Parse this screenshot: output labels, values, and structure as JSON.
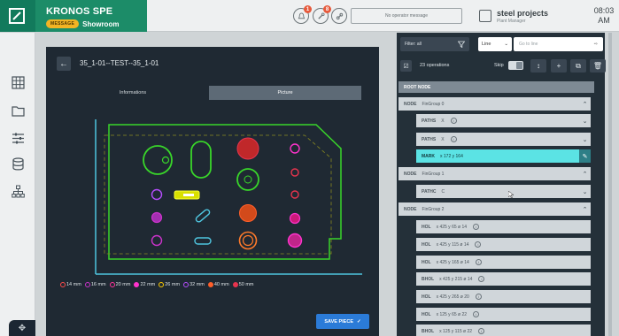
{
  "app": {
    "title": "KRONOS SPE",
    "badge": "MESSAGE",
    "mode": "Showroom",
    "notifications": [
      {
        "icon": "alert-bell-icon",
        "count": "1"
      },
      {
        "icon": "tool-icon",
        "count": "8"
      },
      {
        "icon": "link-icon",
        "count": ""
      }
    ],
    "operator_message": "No operator message",
    "plant": {
      "name": "steel projects",
      "role": "Plant Manager"
    },
    "clock": {
      "time": "08:03",
      "period": "AM"
    }
  },
  "nav": {
    "items": [
      "grid-icon",
      "folder-icon",
      "sliders-icon",
      "database-icon",
      "hierarchy-icon"
    ],
    "bottom_icon": "move-icon"
  },
  "main": {
    "part_title": "35_1-01--TEST--35_1-01",
    "tabs": [
      "Informations",
      "Picture"
    ],
    "active_tab": "Picture",
    "legend": [
      {
        "label": "14 mm",
        "color": "#ff4a4a"
      },
      {
        "label": "16 mm",
        "color": "#cc33cc"
      },
      {
        "label": "20 mm",
        "color": "#ff3399"
      },
      {
        "label": "22 mm",
        "color": "#ff33cc"
      },
      {
        "label": "26 mm",
        "color": "#ffcc00"
      },
      {
        "label": "32 mm",
        "color": "#b64dff"
      },
      {
        "label": "40 mm",
        "color": "#ff5f2a"
      },
      {
        "label": "50 mm",
        "color": "#e8344e"
      }
    ],
    "save_label": "SAVE PIECE"
  },
  "right": {
    "filter": "Filter: all",
    "line_select": "Line",
    "line_placeholder": "Go to line",
    "operations": "23 operations",
    "skip_label": "Skip",
    "tree_header": "ROOT NODE",
    "rows": [
      {
        "kind": "node",
        "kw": "NODE",
        "text": "FinGroup 0",
        "expanded": true
      },
      {
        "kind": "sub",
        "kw": "PATHS",
        "text": "X",
        "info": true
      },
      {
        "kind": "sub",
        "kw": "PATHS",
        "text": "X",
        "info": true
      },
      {
        "kind": "mark",
        "kw": "MARK",
        "text": "x 172 y 164"
      },
      {
        "kind": "node",
        "kw": "NODE",
        "text": "FinGroup 1",
        "expanded": true
      },
      {
        "kind": "sub",
        "kw": "PATHC",
        "text": "C"
      },
      {
        "kind": "node",
        "kw": "NODE",
        "text": "FinGroup 2",
        "expanded": true
      },
      {
        "kind": "op",
        "kw": "HOL",
        "text": "x 425 y 65 ø 14",
        "info": true
      },
      {
        "kind": "op",
        "kw": "HOL",
        "text": "x 425 y 115 ø 14",
        "info": true
      },
      {
        "kind": "op",
        "kw": "HOL",
        "text": "x 425 y 165 ø 14",
        "info": true
      },
      {
        "kind": "op",
        "kw": "BHOL",
        "text": "x 425 y 215 ø 14",
        "info": true
      },
      {
        "kind": "op",
        "kw": "HOL",
        "text": "x 425 y 265 ø 20",
        "info": true
      },
      {
        "kind": "op",
        "kw": "HOL",
        "text": "x 125 y 65 ø 22",
        "info": true
      },
      {
        "kind": "op",
        "kw": "BHOL",
        "text": "x 125 y 115 ø 22",
        "info": true
      }
    ]
  }
}
